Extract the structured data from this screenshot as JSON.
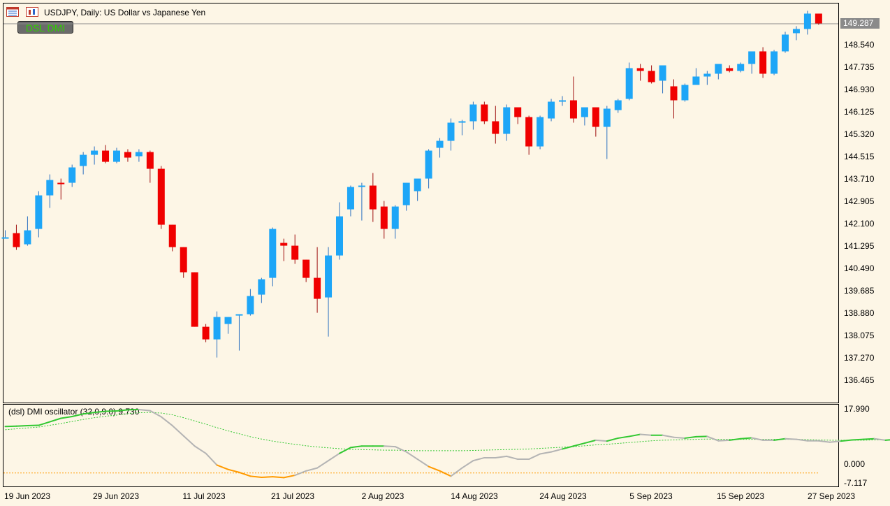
{
  "window": {
    "symbol_title": "USDJPY, Daily:  US Dollar vs Japanese Yen",
    "badge_label": "DSL DMI",
    "indicator_title": "(dsl) DMI oscillator  (32,0,9.0) 9.730",
    "current_price": "149.287"
  },
  "colors": {
    "background": "#fdf6e6",
    "bull": "#1ea6f7",
    "bear": "#f00000",
    "osc_up": "#32c832",
    "osc_neutral": "#b4b4b4",
    "osc_down": "#ff9a00",
    "signal_line": "#32c832",
    "badge_text": "#32d000"
  },
  "icons": [
    "chart-window-icon",
    "chart-type-icon"
  ],
  "price_axis": [
    "149.287",
    "148.540",
    "147.735",
    "146.930",
    "146.125",
    "145.320",
    "144.515",
    "143.710",
    "142.905",
    "142.100",
    "141.295",
    "140.490",
    "139.685",
    "138.880",
    "138.075",
    "137.270",
    "136.465"
  ],
  "indicator_axis": [
    "17.990",
    "0.000",
    "-7.117"
  ],
  "date_axis": [
    "19 Jun 2023",
    "29 Jun 2023",
    "11 Jul 2023",
    "21 Jul 2023",
    "2 Aug 2023",
    "14 Aug 2023",
    "24 Aug 2023",
    "5 Sep 2023",
    "15 Sep 2023",
    "27 Sep 2023"
  ],
  "chart_data": [
    {
      "type": "candlestick",
      "title": "USDJPY, Daily:  US Dollar vs Japanese Yen",
      "ylim": [
        136.0,
        149.6
      ],
      "candles": [
        [
          141.65,
          141.9,
          141.65,
          141.65
        ],
        [
          141.8,
          142.1,
          141.2,
          141.3
        ],
        [
          141.4,
          142.4,
          141.35,
          141.9
        ],
        [
          141.95,
          143.3,
          141.65,
          143.15
        ],
        [
          143.15,
          143.9,
          142.7,
          143.7
        ],
        [
          143.6,
          143.75,
          143.0,
          143.55
        ],
        [
          143.6,
          144.25,
          143.45,
          144.15
        ],
        [
          144.2,
          144.7,
          143.9,
          144.6
        ],
        [
          144.6,
          144.9,
          144.25,
          144.75
        ],
        [
          144.75,
          144.95,
          144.3,
          144.35
        ],
        [
          144.35,
          144.85,
          144.3,
          144.75
        ],
        [
          144.7,
          144.8,
          144.35,
          144.5
        ],
        [
          144.55,
          144.8,
          144.35,
          144.7
        ],
        [
          144.7,
          144.75,
          143.6,
          144.1
        ],
        [
          144.1,
          144.2,
          141.95,
          142.1
        ],
        [
          142.1,
          142.1,
          141.15,
          141.3
        ],
        [
          141.3,
          141.3,
          140.2,
          140.4
        ],
        [
          140.4,
          140.4,
          138.45,
          138.45
        ],
        [
          138.45,
          138.55,
          137.9,
          138.0
        ],
        [
          138.0,
          139.0,
          137.35,
          138.8
        ],
        [
          138.55,
          138.8,
          138.2,
          138.8
        ],
        [
          138.85,
          138.9,
          137.6,
          138.9
        ],
        [
          138.9,
          139.8,
          138.85,
          139.55
        ],
        [
          139.6,
          140.2,
          139.3,
          140.15
        ],
        [
          140.2,
          142.0,
          139.9,
          141.95
        ],
        [
          141.45,
          141.6,
          140.8,
          141.35
        ],
        [
          141.35,
          141.75,
          140.7,
          140.85
        ],
        [
          140.85,
          140.85,
          140.05,
          140.2
        ],
        [
          140.2,
          141.3,
          138.95,
          139.45
        ],
        [
          139.5,
          141.3,
          138.1,
          141.0
        ],
        [
          141.0,
          142.9,
          140.85,
          142.4
        ],
        [
          142.65,
          143.5,
          142.4,
          143.45
        ],
        [
          143.45,
          143.6,
          142.25,
          143.5
        ],
        [
          143.5,
          143.95,
          142.2,
          142.65
        ],
        [
          142.75,
          142.95,
          141.6,
          141.95
        ],
        [
          141.95,
          142.8,
          141.6,
          142.75
        ],
        [
          142.8,
          143.6,
          142.6,
          143.6
        ],
        [
          143.3,
          143.7,
          142.95,
          143.75
        ],
        [
          143.75,
          144.8,
          143.4,
          144.75
        ],
        [
          144.85,
          145.2,
          144.5,
          145.1
        ],
        [
          145.1,
          145.9,
          144.75,
          145.75
        ],
        [
          145.75,
          145.85,
          145.3,
          145.8
        ],
        [
          145.8,
          146.5,
          145.5,
          146.4
        ],
        [
          146.4,
          146.5,
          145.7,
          145.8
        ],
        [
          145.8,
          146.35,
          145.0,
          145.35
        ],
        [
          145.35,
          146.4,
          145.1,
          146.3
        ],
        [
          146.3,
          146.3,
          145.7,
          145.95
        ],
        [
          145.95,
          146.0,
          144.6,
          144.9
        ],
        [
          144.9,
          146.0,
          144.8,
          145.95
        ],
        [
          145.9,
          146.6,
          145.8,
          146.5
        ],
        [
          146.5,
          146.7,
          146.35,
          146.55
        ],
        [
          146.55,
          147.4,
          145.75,
          145.9
        ],
        [
          145.95,
          146.3,
          145.65,
          146.3
        ],
        [
          146.3,
          146.3,
          145.25,
          145.6
        ],
        [
          145.6,
          146.35,
          144.45,
          146.25
        ],
        [
          146.2,
          146.6,
          146.1,
          146.55
        ],
        [
          146.6,
          147.9,
          146.55,
          147.7
        ],
        [
          147.7,
          147.85,
          147.25,
          147.6
        ],
        [
          147.6,
          147.8,
          147.15,
          147.2
        ],
        [
          147.25,
          147.8,
          146.8,
          147.8
        ],
        [
          147.05,
          147.3,
          145.9,
          146.55
        ],
        [
          146.55,
          147.15,
          146.5,
          147.1
        ],
        [
          147.1,
          147.7,
          147.1,
          147.4
        ],
        [
          147.4,
          147.6,
          147.1,
          147.5
        ],
        [
          147.5,
          147.8,
          147.3,
          147.85
        ],
        [
          147.7,
          147.8,
          147.55,
          147.6
        ],
        [
          147.6,
          147.9,
          147.55,
          147.85
        ],
        [
          147.85,
          148.3,
          147.5,
          148.3
        ],
        [
          148.3,
          148.45,
          147.35,
          147.5
        ],
        [
          147.5,
          148.35,
          147.45,
          148.3
        ],
        [
          148.3,
          149.0,
          148.25,
          148.9
        ],
        [
          148.95,
          149.2,
          148.7,
          149.1
        ],
        [
          149.1,
          149.75,
          148.9,
          149.65
        ],
        [
          149.65,
          149.65,
          149.25,
          149.3
        ]
      ]
    },
    {
      "type": "line",
      "title": "(dsl) DMI oscillator  (32,0,9.0) 9.730",
      "ylim": [
        -7.117,
        17.99
      ],
      "series": [
        {
          "role": "oscillator",
          "values": [
            12.2,
            12.3,
            12.5,
            12.6,
            13.8,
            15.0,
            15.6,
            16.5,
            17.0,
            17.4,
            17.5,
            17.9,
            18.0,
            17.6,
            15.5,
            12.5,
            9.0,
            5.5,
            3.0,
            -1.0,
            -2.5,
            -3.5,
            -4.8,
            -5.2,
            -5.0,
            -5.3,
            -4.5,
            -3.0,
            -2.0,
            0.5,
            3.0,
            5.0,
            5.5,
            5.5,
            5.5,
            5.3,
            3.5,
            1.0,
            -1.5,
            -3.0,
            -4.8,
            -2.0,
            0.5,
            1.5,
            1.5,
            2.0,
            1.0,
            1.0,
            2.8,
            3.5,
            4.5,
            5.5,
            6.5,
            7.5,
            7.2,
            8.2,
            8.8,
            9.5,
            9.2,
            9.2,
            8.5,
            8.2,
            8.7,
            8.8,
            7.3,
            7.5,
            8.0,
            8.3,
            7.5,
            7.5,
            8.0,
            7.8,
            7.3,
            7.3,
            6.8,
            7.2,
            7.6,
            7.8,
            8.0,
            7.5,
            7.8,
            8.5,
            9.0,
            9.7
          ]
        },
        {
          "role": "signal",
          "values": [
            11.1,
            11.4,
            11.7,
            12.0,
            12.6,
            13.2,
            13.9,
            14.6,
            15.2,
            15.7,
            16.1,
            16.6,
            16.9,
            17.0,
            16.8,
            16.2,
            15.2,
            14.1,
            13.0,
            11.8,
            10.7,
            9.7,
            8.7,
            7.9,
            7.2,
            6.6,
            6.1,
            5.6,
            5.2,
            4.9,
            4.6,
            4.4,
            4.3,
            4.2,
            4.1,
            4.1,
            4.0,
            3.9,
            3.9,
            3.9,
            3.9,
            3.9,
            4.0,
            4.1,
            4.2,
            4.3,
            4.4,
            4.5,
            4.7,
            4.9,
            5.1,
            5.3,
            5.6,
            5.9,
            6.1,
            6.4,
            6.7,
            7.0,
            7.3,
            7.5,
            7.6,
            7.7,
            7.8,
            7.9,
            7.8,
            7.8,
            7.8,
            7.8,
            7.8,
            7.8,
            7.8,
            7.8,
            7.7,
            7.6,
            7.5,
            7.5,
            7.5,
            7.5,
            7.6,
            7.6,
            7.7,
            7.9,
            8.2,
            8.6
          ]
        },
        {
          "role": "lower-level",
          "values": [
            -3.7
          ]
        }
      ]
    }
  ]
}
